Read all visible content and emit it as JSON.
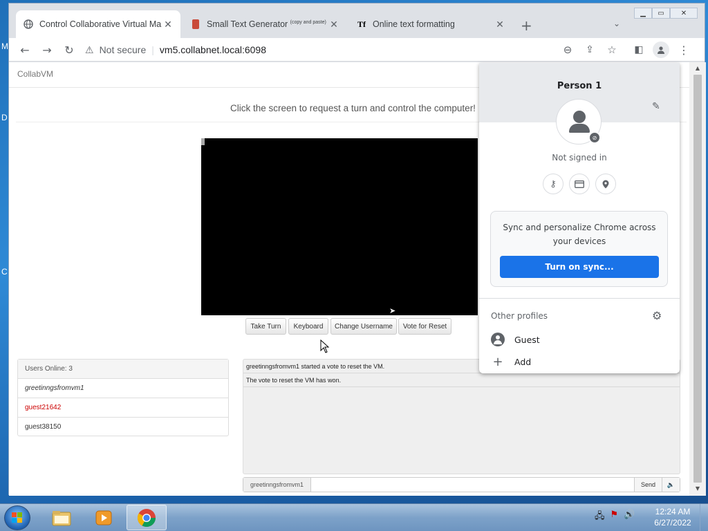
{
  "desktop": {
    "edge_letters": [
      "M",
      "D",
      "C"
    ]
  },
  "browser": {
    "tabs": [
      {
        "icon": "globe-icon",
        "title": "Control Collaborative Virtual Ma",
        "active": true
      },
      {
        "icon": "text-generator-icon",
        "title": "Small Text Generator",
        "title_sup": "(copy and paste)"
      },
      {
        "icon": "tf-icon",
        "title": "Online text formatting",
        "icon_text": "Tf"
      }
    ],
    "new_tab": "+",
    "address": {
      "security": "Not secure",
      "url": "vm5.collabnet.local:6098"
    }
  },
  "page": {
    "brand": "CollabVM",
    "prompt": "Click the screen to request a turn and control the computer!",
    "buttons": {
      "take_turn": "Take Turn",
      "keyboard": "Keyboard",
      "change_username": "Change Username",
      "vote_reset": "Vote for Reset"
    },
    "users": {
      "header": "Users Online: 3",
      "list": [
        "greetinngsfromvm1",
        "guest21642",
        "guest38150"
      ]
    },
    "chat": {
      "messages": [
        "greetinngsfromvm1 started a vote to reset the VM.",
        "The vote to reset the VM has won."
      ],
      "username": "greetinngsfromvm1",
      "input_value": "",
      "send": "Send"
    }
  },
  "profile_menu": {
    "name": "Person 1",
    "status": "Not signed in",
    "sync_text": "Sync and personalize Chrome across your devices",
    "sync_button": "Turn on sync...",
    "other_profiles_title": "Other profiles",
    "other_profiles": [
      "Guest",
      "Add"
    ]
  },
  "taskbar": {
    "time": "12:24 AM",
    "date": "6/27/2022"
  },
  "colors": {
    "sync_button": "#1a73e8",
    "current_user": "#cc0000"
  }
}
